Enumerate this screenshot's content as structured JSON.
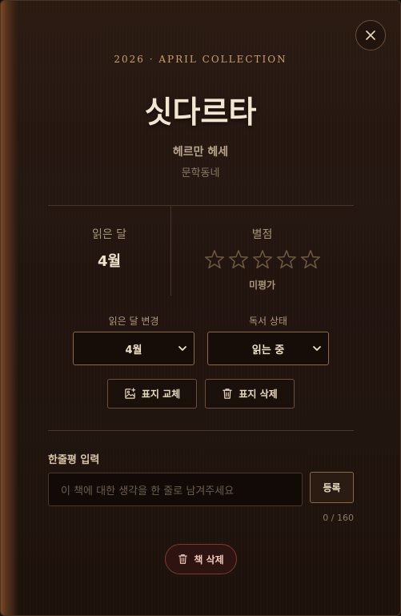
{
  "header": {
    "collection": "2026 · APRIL COLLECTION",
    "title": "싯다르타",
    "author": "헤르만 헤세",
    "publisher": "문학동네"
  },
  "stats": {
    "month_label": "읽은 달",
    "month_value": "4월",
    "rating_label": "별점",
    "rating_value": 0,
    "rating_max": 5,
    "rating_text": "미평가"
  },
  "controls": {
    "month_select_label": "읽은 달 변경",
    "month_selected": "4월",
    "status_select_label": "독서 상태",
    "status_selected": "읽는 중",
    "replace_cover_label": "표지 교체",
    "delete_cover_label": "표지 삭제"
  },
  "review": {
    "label": "한줄평 입력",
    "placeholder": "이 책에 대한 생각을 한 줄로 남겨주세요",
    "submit_label": "등록",
    "char_count": "0 / 160"
  },
  "footer": {
    "delete_book_label": "책 삭제"
  },
  "icons": {
    "close": "close-icon",
    "star": "star-outline-icon",
    "chevron": "chevron-down-icon",
    "image_add": "image-add-icon",
    "trash": "trash-icon"
  },
  "colors": {
    "accent_gold": "#c9a06a",
    "background": "#221510",
    "danger": "#7a3a32"
  }
}
